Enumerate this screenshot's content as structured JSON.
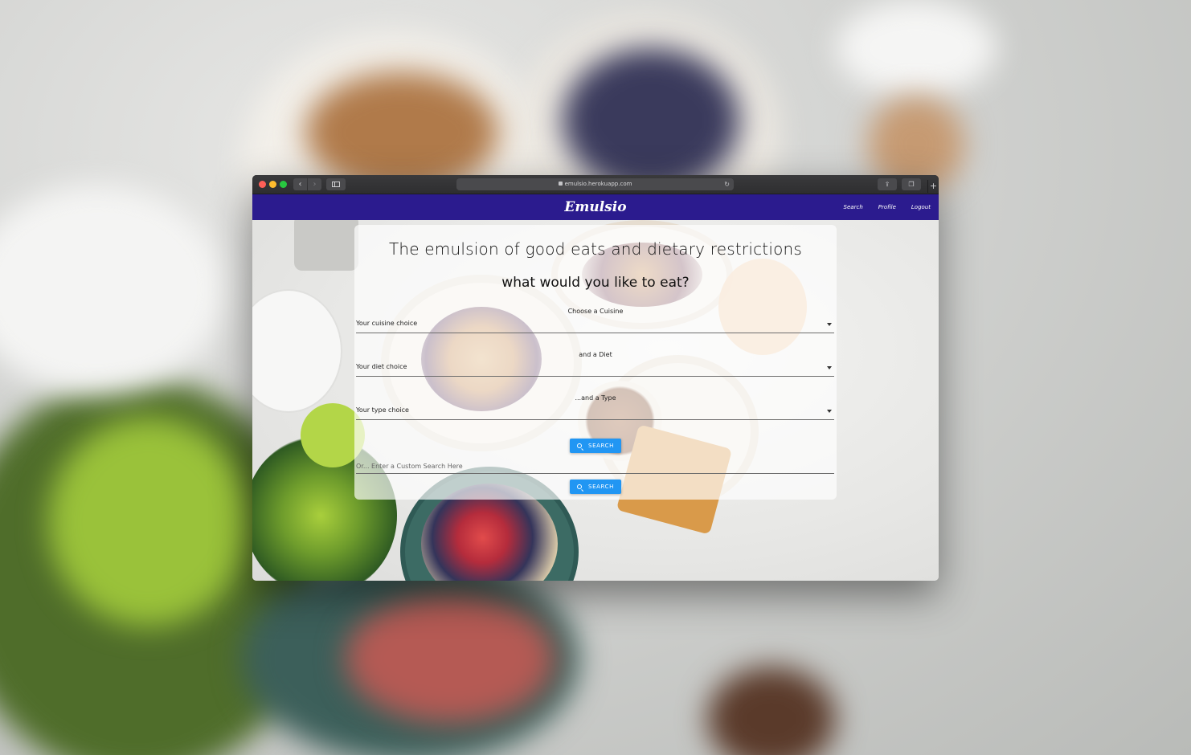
{
  "browser": {
    "url": "emulsio.herokuapp.com",
    "back_icon": "‹",
    "forward_icon": "›",
    "reload_icon": "↻",
    "share_icon": "⇪",
    "tabs_icon": "❐",
    "new_tab_icon": "+"
  },
  "navbar": {
    "brand": "Emulsio",
    "links": [
      "Search",
      "Profile",
      "Logout"
    ],
    "color": "#2b1b8e"
  },
  "main": {
    "headline": "The emulsion of good eats and dietary restrictions",
    "subhead": "what would you like to eat?",
    "cuisine_label": "Choose a Cuisine",
    "cuisine_select": "Your cuisine choice",
    "diet_label": "and a Diet",
    "diet_select": "Your diet choice",
    "type_label": "...and a Type",
    "type_select": "Your type choice",
    "search_button": "SEARCH",
    "custom_placeholder": "Or... Enter a Custom Search Here",
    "custom_search_button": "SEARCH",
    "button_color": "#2196f3"
  }
}
